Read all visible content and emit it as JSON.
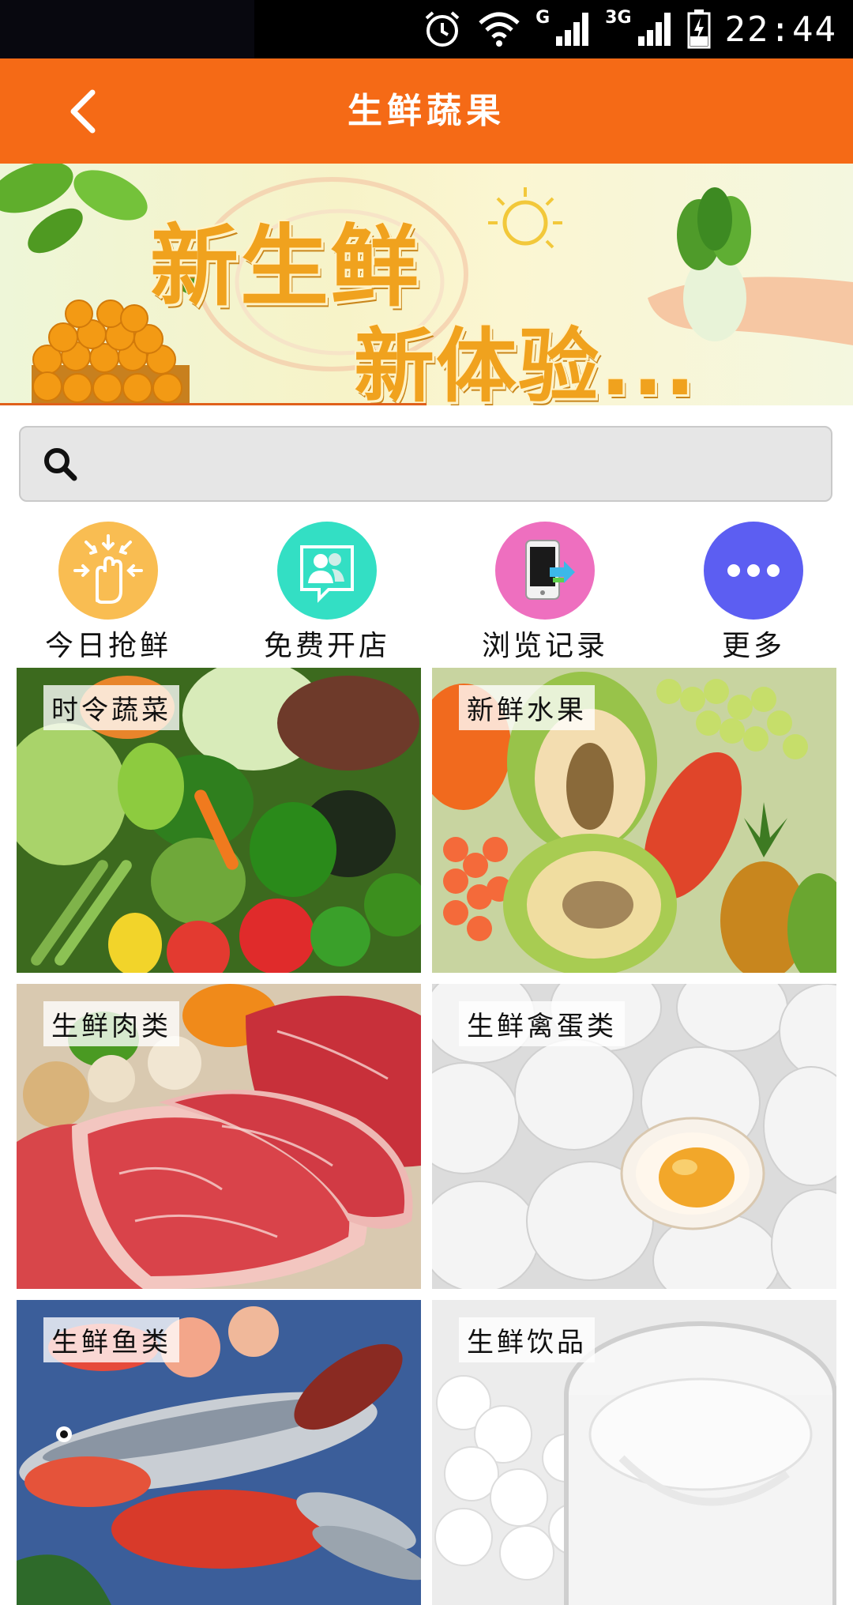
{
  "status_bar": {
    "network_g": "G",
    "network_3g": "3G",
    "time": "22:44",
    "icons": [
      "alarm-icon",
      "wifi-icon",
      "signal-icon",
      "signal-3g-icon",
      "battery-charging-icon"
    ]
  },
  "header": {
    "title": "生鲜蔬果",
    "back_icon": "chevron-left-icon",
    "background": "#f56a16"
  },
  "banner": {
    "line1": "新生鲜",
    "line2": "新体验...",
    "image_description_icons": [
      "oranges-basket",
      "bok-choy-in-hands",
      "sun-doodle"
    ]
  },
  "search": {
    "placeholder": "",
    "value": "",
    "icon": "search-icon"
  },
  "quick_actions": [
    {
      "label": "今日抢鲜",
      "icon": "grab-hand-icon",
      "color": "#f9bd52"
    },
    {
      "label": "免费开店",
      "icon": "contacts-chat-icon",
      "color": "#33dfc4"
    },
    {
      "label": "浏览记录",
      "icon": "phone-transfer-icon",
      "color": "#ee6fbf"
    },
    {
      "label": "更多",
      "icon": "more-dots-icon",
      "color": "#5c5ef2"
    }
  ],
  "categories": [
    {
      "label": "时令蔬菜",
      "image": "vegetables"
    },
    {
      "label": "新鲜水果",
      "image": "fruits"
    },
    {
      "label": "生鲜肉类",
      "image": "meat"
    },
    {
      "label": "生鲜禽蛋类",
      "image": "eggs"
    },
    {
      "label": "生鲜鱼类",
      "image": "fish"
    },
    {
      "label": "生鲜饮品",
      "image": "drinks"
    }
  ]
}
